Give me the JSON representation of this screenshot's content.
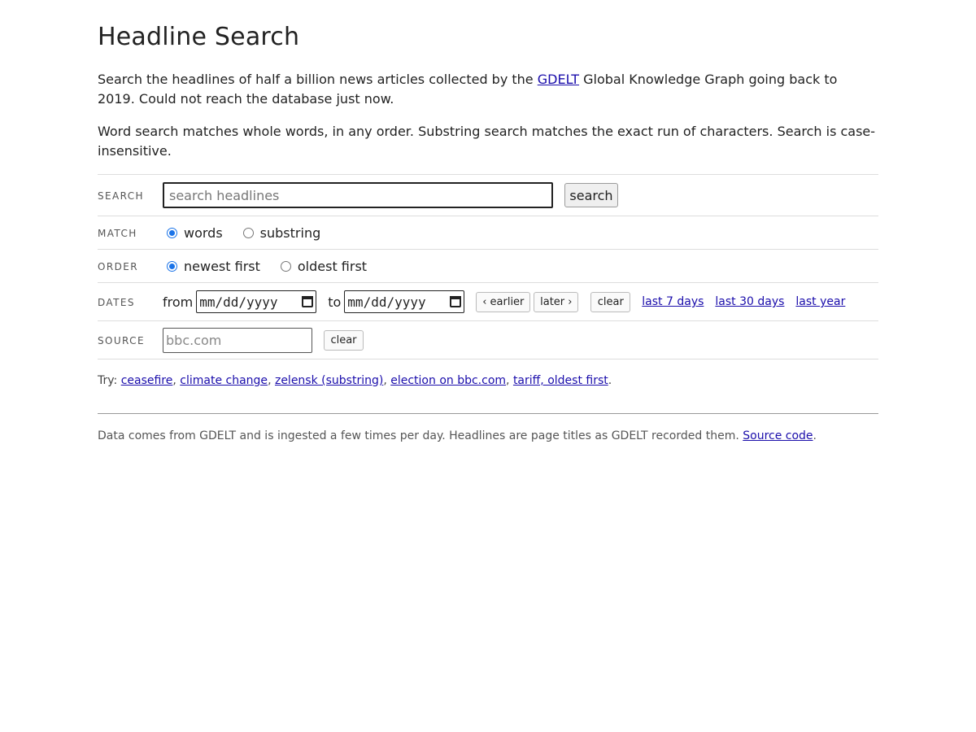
{
  "page": {
    "title": "Headline Search",
    "intro": {
      "before_link": "Search the headlines of half a billion news articles collected by the ",
      "link": "GDELT",
      "after_link": " Global Knowledge Graph going back to 2019. Could not reach the database just now."
    },
    "description": "Word search matches whole words, in any order. Substring search matches the exact run of characters. Search is case-insensitive."
  },
  "form": {
    "search": {
      "label": "SEARCH",
      "placeholder": "search headlines",
      "button": "search"
    },
    "match": {
      "label": "MATCH",
      "options": [
        {
          "label": "words",
          "checked": true
        },
        {
          "label": "substring",
          "checked": false
        }
      ]
    },
    "order": {
      "label": "ORDER",
      "options": [
        {
          "label": "newest first",
          "checked": true
        },
        {
          "label": "oldest first",
          "checked": false
        }
      ]
    },
    "dates": {
      "label": "DATES",
      "from_label": "from",
      "from_value": "mm/dd/yyyy",
      "to_label": "to",
      "to_value": "mm/dd/yyyy",
      "earlier": "‹ earlier",
      "later": "later ›",
      "clear": "clear",
      "quick_links": [
        "last 7 days",
        "last 30 days",
        "last year"
      ]
    },
    "source": {
      "label": "SOURCE",
      "placeholder": "bbc.com",
      "clear": "clear"
    }
  },
  "try": {
    "prefix": "Try: ",
    "links": [
      "ceasefire",
      "climate change",
      "zelensk (substring)",
      "election on bbc.com",
      "tariff, oldest first"
    ]
  },
  "footer": {
    "text": "Data comes from GDELT and is ingested a few times per day. Headlines are page titles as GDELT recorded them. ",
    "link": "Source code"
  }
}
